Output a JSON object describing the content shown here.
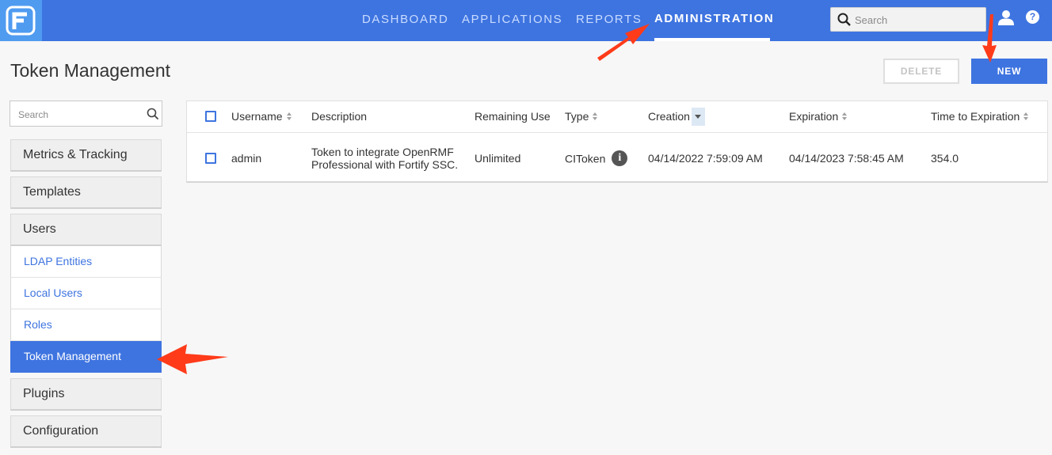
{
  "header": {
    "nav": [
      {
        "label": "DASHBOARD"
      },
      {
        "label": "APPLICATIONS"
      },
      {
        "label": "REPORTS"
      },
      {
        "label": "ADMINISTRATION",
        "active": true
      }
    ],
    "search_placeholder": "Search",
    "icons": [
      "fortify-logo-icon",
      "search-icon",
      "user-icon",
      "help-icon"
    ],
    "help_glyph": "?"
  },
  "page": {
    "title": "Token Management",
    "delete_label": "DELETE",
    "new_label": "NEW"
  },
  "sidebar": {
    "search_placeholder": "Search",
    "groups": {
      "metrics": "Metrics & Tracking",
      "templates": "Templates",
      "users": "Users",
      "plugins": "Plugins",
      "configuration": "Configuration"
    },
    "user_items": [
      {
        "label": "LDAP Entities"
      },
      {
        "label": "Local Users"
      },
      {
        "label": "Roles"
      },
      {
        "label": "Token Management",
        "active": true
      }
    ]
  },
  "table": {
    "columns": [
      "Username",
      "Description",
      "Remaining Use",
      "Type",
      "Creation",
      "Expiration",
      "Time to Expiration"
    ],
    "rows": [
      {
        "username": "admin",
        "description": "Token to integrate OpenRMF Professional with Fortify SSC.",
        "remaining_use": "Unlimited",
        "type": "CIToken",
        "creation": "04/14/2022 7:59:09 AM",
        "expiration": "04/14/2023 7:58:45 AM",
        "time_to_expiration": "354.0"
      }
    ],
    "info_glyph": "i"
  },
  "colors": {
    "accent": "#3e74e0",
    "logo_bg": "#4f9bf0",
    "annotation_arrow": "#ff3b1a"
  }
}
